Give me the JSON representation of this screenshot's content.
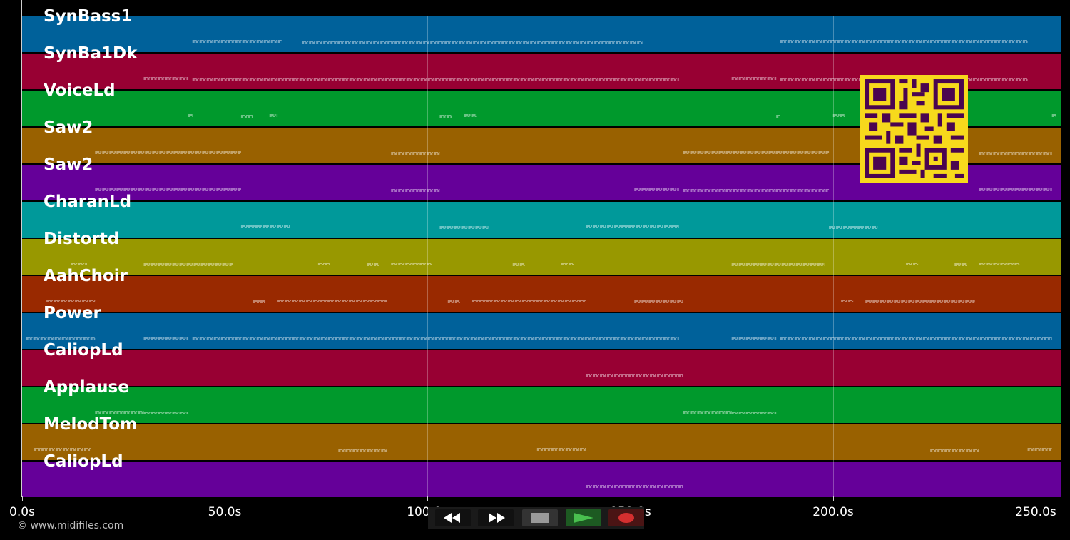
{
  "tracks": [
    {
      "name": "SynBass1",
      "color": "#00619a"
    },
    {
      "name": "SynBa1Dk",
      "color": "#980033"
    },
    {
      "name": "VoiceLd",
      "color": "#00992c"
    },
    {
      "name": "Saw2",
      "color": "#996100"
    },
    {
      "name": "Saw2",
      "color": "#650099"
    },
    {
      "name": "CharanLd",
      "color": "#00999a"
    },
    {
      "name": "Distortd",
      "color": "#989800"
    },
    {
      "name": "AahChoir",
      "color": "#992900"
    },
    {
      "name": "Power",
      "color": "#00619a"
    },
    {
      "name": "CaliopLd",
      "color": "#980033"
    },
    {
      "name": "Applause",
      "color": "#00992c"
    },
    {
      "name": "MelodTom",
      "color": "#996100"
    },
    {
      "name": "CaliopLd",
      "color": "#650099"
    }
  ],
  "timeline": {
    "ticks": [
      "0.0s",
      "50.0s",
      "100.0s",
      "150.0s",
      "200.0s",
      "250.0s"
    ],
    "tick_values": [
      0,
      50,
      100,
      150,
      200,
      250
    ]
  },
  "copyright": "© www.midifiles.com",
  "controls": {
    "rewind_icon": "rewind-icon",
    "forward_icon": "fast-forward-icon",
    "stop_icon": "stop-icon",
    "play_icon": "play-icon",
    "record_icon": "record-icon"
  },
  "qr_icon": "qr-code-icon",
  "note_segments": [
    [
      [
        42,
        64
      ],
      [
        69,
        153
      ],
      [
        187,
        248
      ]
    ],
    [
      [
        30,
        41
      ],
      [
        42,
        162
      ],
      [
        175,
        186
      ],
      [
        187,
        248
      ]
    ],
    [
      [
        41,
        42
      ],
      [
        54,
        57
      ],
      [
        61,
        63
      ],
      [
        103,
        106
      ],
      [
        109,
        112
      ],
      [
        186,
        187
      ],
      [
        200,
        203
      ],
      [
        212,
        215
      ],
      [
        254,
        255
      ]
    ],
    [
      [
        18,
        54
      ],
      [
        91,
        103
      ],
      [
        163,
        199
      ],
      [
        236,
        254
      ]
    ],
    [
      [
        18,
        54
      ],
      [
        91,
        103
      ],
      [
        151,
        162
      ],
      [
        163,
        199
      ],
      [
        236,
        254
      ]
    ],
    [
      [
        54,
        66
      ],
      [
        103,
        115
      ],
      [
        139,
        162
      ],
      [
        199,
        211
      ]
    ],
    [
      [
        12,
        16
      ],
      [
        30,
        52
      ],
      [
        73,
        76
      ],
      [
        85,
        88
      ],
      [
        91,
        101
      ],
      [
        121,
        124
      ],
      [
        133,
        136
      ],
      [
        175,
        198
      ],
      [
        218,
        221
      ],
      [
        230,
        233
      ],
      [
        236,
        246
      ]
    ],
    [
      [
        6,
        18
      ],
      [
        57,
        60
      ],
      [
        63,
        90
      ],
      [
        105,
        108
      ],
      [
        111,
        139
      ],
      [
        151,
        163
      ],
      [
        202,
        205
      ],
      [
        208,
        235
      ]
    ],
    [
      [
        1,
        18
      ],
      [
        30,
        41
      ],
      [
        42,
        162
      ],
      [
        175,
        186
      ],
      [
        187,
        254
      ]
    ],
    [
      [
        139,
        163
      ]
    ],
    [
      [
        18,
        30
      ],
      [
        30,
        41
      ],
      [
        163,
        175
      ],
      [
        175,
        186
      ]
    ],
    [
      [
        3,
        17
      ],
      [
        78,
        90
      ],
      [
        127,
        139
      ],
      [
        224,
        236
      ],
      [
        248,
        254
      ]
    ],
    [
      [
        139,
        163
      ]
    ]
  ]
}
